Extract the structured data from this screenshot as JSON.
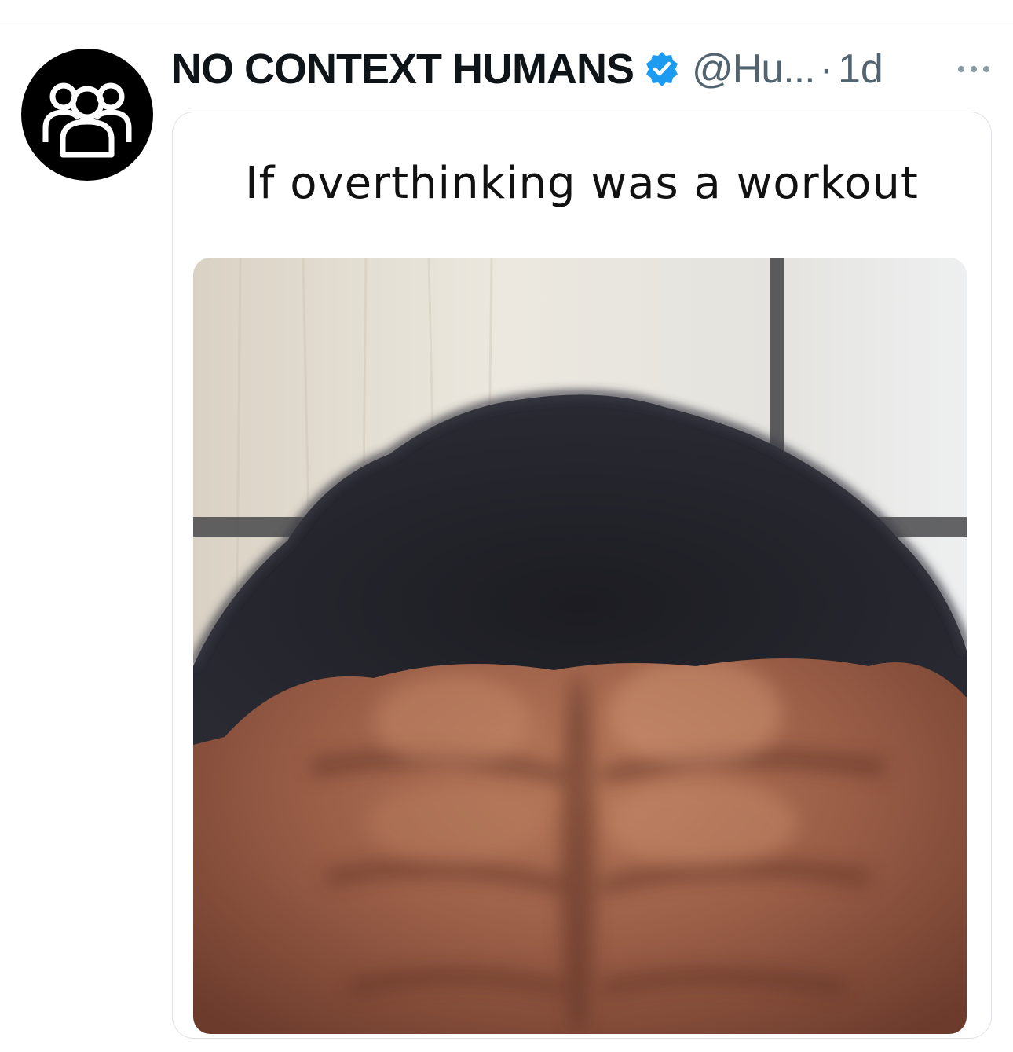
{
  "post": {
    "author": {
      "display_name": "NO CONTEXT HUMANS",
      "verified": true,
      "handle": "@Hu...",
      "separator": "·",
      "age": "1d",
      "avatar_icon": "people-group-icon"
    },
    "media": {
      "caption": "If overthinking was a workout"
    },
    "more_icon": "more-horizontal-icon"
  },
  "colors": {
    "verified_blue": "#1d9bf0",
    "secondary_text": "#536471",
    "primary_text": "#0f1419",
    "border": "#dfe3e7"
  }
}
